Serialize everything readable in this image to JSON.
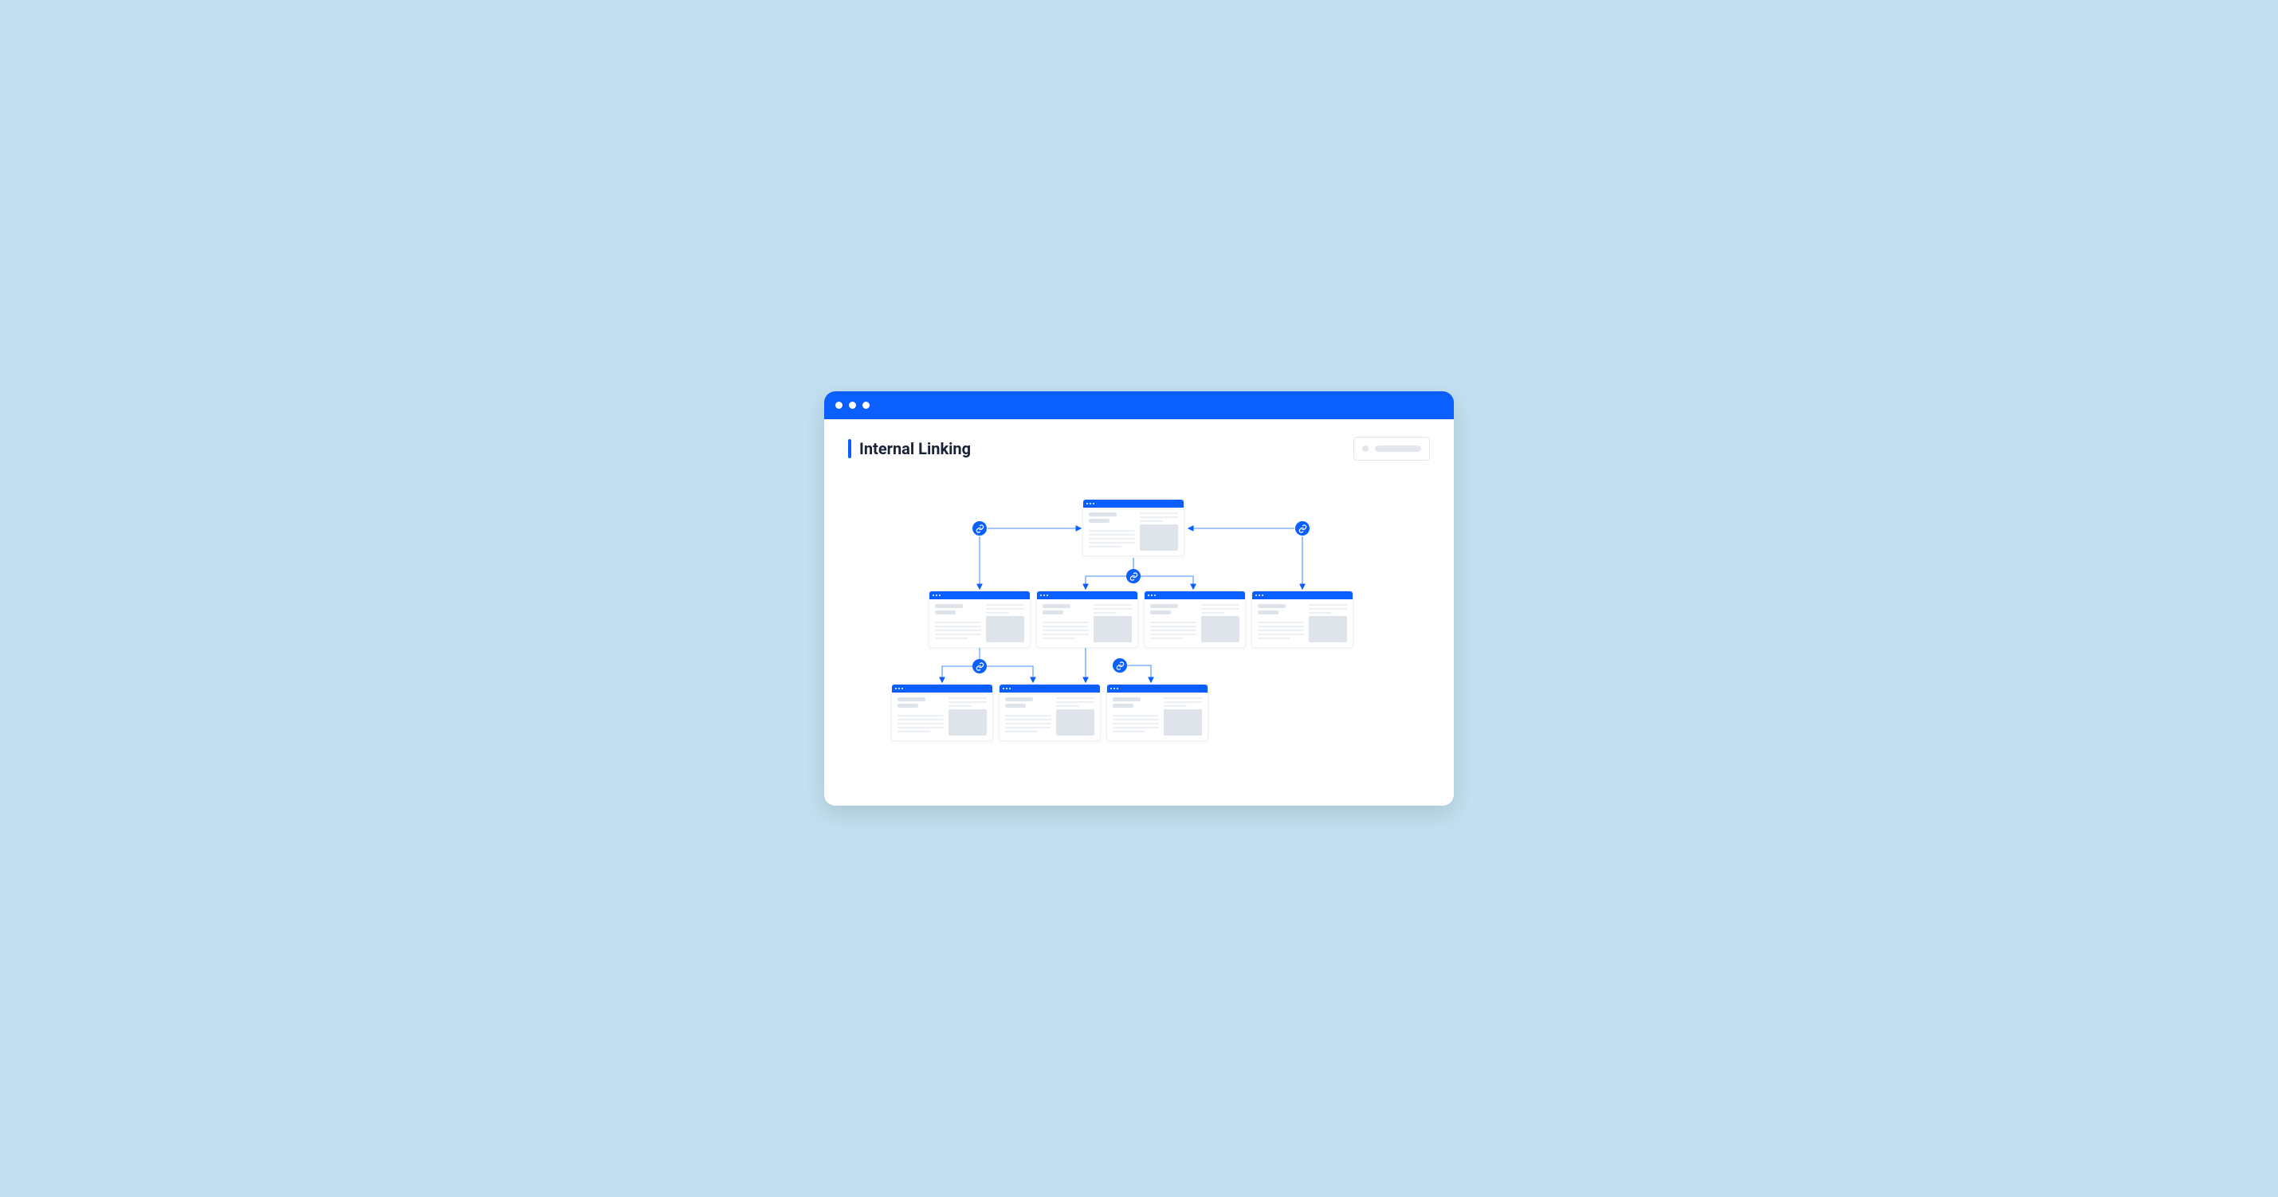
{
  "title": "Internal Linking",
  "colors": {
    "background": "#c2e0f0",
    "accent": "#0b5fff",
    "text": "#1a2238",
    "placeholder": "#dfe3ea"
  },
  "diagram": {
    "description": "Hierarchical site map showing a root page linking to four child pages; the first and second child pages each link to further sub-pages via internal links.",
    "nodes": [
      {
        "id": "root",
        "level": 0
      },
      {
        "id": "c1",
        "level": 1
      },
      {
        "id": "c2",
        "level": 1
      },
      {
        "id": "c3",
        "level": 1
      },
      {
        "id": "c4",
        "level": 1
      },
      {
        "id": "g1",
        "level": 2
      },
      {
        "id": "g2",
        "level": 2
      },
      {
        "id": "g3",
        "level": 2
      }
    ],
    "links": [
      {
        "from": "root",
        "to": "c1",
        "bidirectional": true
      },
      {
        "from": "root",
        "to": "c4",
        "bidirectional": true
      },
      {
        "from": "root",
        "to": "c2",
        "bidirectional": true
      },
      {
        "from": "root",
        "to": "c3",
        "bidirectional": true
      },
      {
        "from": "c1",
        "to": "g1",
        "bidirectional": true
      },
      {
        "from": "c1",
        "to": "g2",
        "bidirectional": true
      },
      {
        "from": "c2",
        "to": "g3",
        "bidirectional": true
      }
    ]
  }
}
